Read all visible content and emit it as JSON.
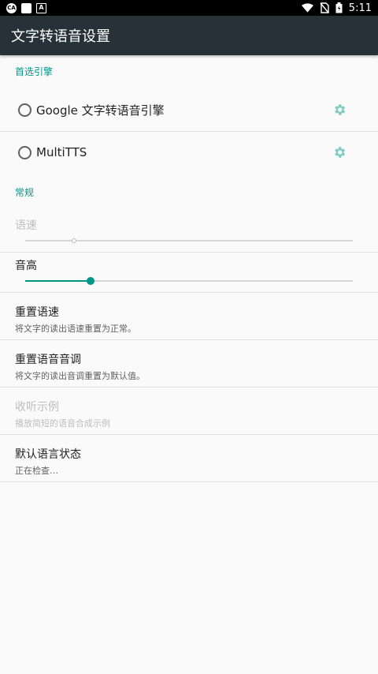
{
  "status_bar": {
    "time": "5:11",
    "left_icons": [
      "ca-icon",
      "square-icon",
      "a-icon"
    ],
    "right_icons": [
      "wifi-icon",
      "no-sim-icon",
      "battery-icon"
    ]
  },
  "app_bar": {
    "title": "文字转语音设置"
  },
  "sections": {
    "preferred_engine": {
      "header": "首选引擎",
      "engines": [
        {
          "label": "Google 文字转语音引擎",
          "selected": false
        },
        {
          "label": "MultiTTS",
          "selected": false
        }
      ]
    },
    "general": {
      "header": "常规",
      "speech_rate": {
        "title": "语速",
        "enabled": false,
        "value": 0.15
      },
      "pitch": {
        "title": "音高",
        "enabled": true,
        "value": 0.2
      },
      "reset_rate": {
        "title": "重置语速",
        "summary": "将文字的读出语速重置为正常。"
      },
      "reset_pitch": {
        "title": "重置语音音调",
        "summary": "将文字的读出音调重置为默认值。"
      },
      "listen_example": {
        "title": "收听示例",
        "summary": "播放简短的语音合成示例",
        "enabled": false
      },
      "default_language_status": {
        "title": "默认语言状态",
        "summary": "正在检查…"
      }
    }
  },
  "colors": {
    "accent": "#009688",
    "app_bar": "#263238",
    "divider": "#e0e0e0"
  }
}
